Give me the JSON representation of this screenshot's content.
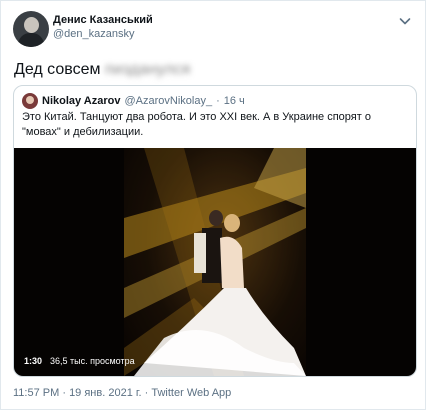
{
  "tweet": {
    "author_name": "Денис Казанський",
    "author_handle": "@den_kazansky",
    "text": "Дед совсем",
    "text_blurred": "пизданулся",
    "timestamp": "11:57 PM",
    "date": "19 янв. 2021 г.",
    "source": "Twitter Web App",
    "separator": " · "
  },
  "quoted": {
    "author_name": "Nikolay Azarov",
    "author_handle": "@AzarovNikolay_",
    "time": "16 ч",
    "separator": "·",
    "text": "Это Китай. Танцуют два робота. И это XXI век. А в Украине спорят о \"мовах\" и дебилизации."
  },
  "video": {
    "duration": "1:30",
    "views": "36,5 тыс. просмотра"
  },
  "icons": {
    "more": "chevron-down-icon"
  }
}
